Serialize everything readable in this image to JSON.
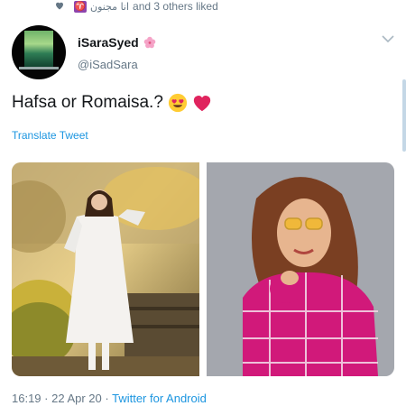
{
  "liked": {
    "name": "انا مجنون",
    "badge": "♈",
    "suffix": "and 3 others liked"
  },
  "tweet": {
    "display_name": "iSaraSyed",
    "handle": "@iSadSara",
    "text": "Hafsa or Romaisa.?",
    "translate_label": "Translate Tweet",
    "time": "16:19",
    "date": "22 Apr 20",
    "source": "Twitter for Android",
    "separator": " · "
  },
  "colors": {
    "link": "#1b95e0",
    "secondary": "#657786",
    "text": "#14171a"
  }
}
